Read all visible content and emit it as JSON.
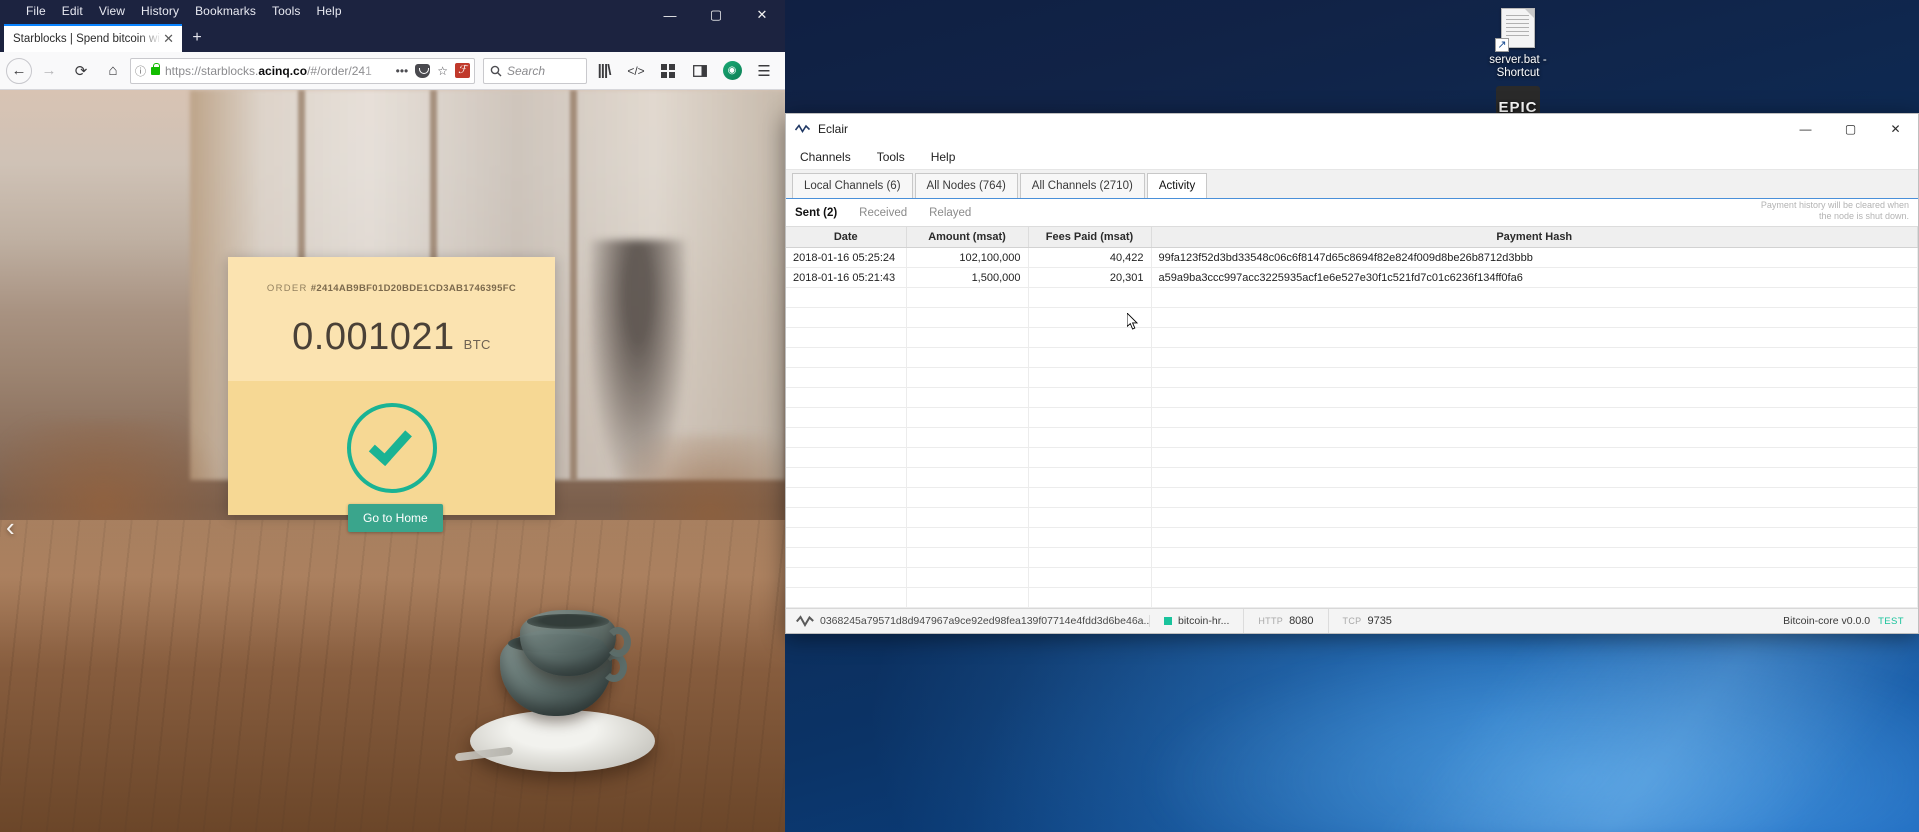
{
  "desktop": {
    "icons": [
      {
        "name": "server.bat - Shortcut",
        "label": "server.bat - Shortcut",
        "type": "bat-shortcut",
        "arrow": "↗"
      },
      {
        "name": "EPIC",
        "label": "EPIC",
        "type": "epic",
        "glyph": "EPIC"
      }
    ]
  },
  "browser": {
    "menu": [
      "File",
      "Edit",
      "View",
      "History",
      "Bookmarks",
      "Tools",
      "Help"
    ],
    "window_controls": {
      "minimize": "—",
      "maximize": "▢",
      "close": "✕"
    },
    "tab": {
      "title": "Starblocks | Spend bitcoin with LN c",
      "close": "✕"
    },
    "new_tab": "+",
    "nav": {
      "back": "←",
      "forward": "→",
      "reload": "⟳",
      "home": "⌂"
    },
    "url": {
      "prefix": "https://starblocks.",
      "domain": "acinq.co",
      "suffix": "/#/order/241",
      "identity_icon": "ⓘ",
      "lock_icon": "lock"
    },
    "urlbar_actions": {
      "more": "•••",
      "pocket": "pocket-icon",
      "bookmark": "☆",
      "extension": "ℱ"
    },
    "search": {
      "placeholder": "Search",
      "icon": "🔍"
    },
    "toolbar_right": {
      "library": "library-icon",
      "devtools": "</>",
      "addons": "grid-icon",
      "sidebar": "sidebar-icon",
      "account": "account-icon",
      "menu": "☰"
    }
  },
  "page": {
    "order_label": "ORDER",
    "order_id": "#2414AB9BF01D20BDE1CD3AB1746395FC",
    "amount": "0.001021",
    "unit": "BTC",
    "status_icon": "check-circle",
    "home_button": "Go to Home",
    "carousel_prev": "‹",
    "accent": "#1ab394",
    "card_top_bg": "#fbe3b0",
    "card_bottom_bg": "#f6d894"
  },
  "eclair": {
    "title": "Eclair",
    "window_controls": {
      "minimize": "—",
      "maximize": "▢",
      "close": "✕"
    },
    "menu": [
      "Channels",
      "Tools",
      "Help"
    ],
    "tabs": [
      {
        "label": "Local Channels (6)",
        "active": false
      },
      {
        "label": "All Nodes (764)",
        "active": false
      },
      {
        "label": "All Channels (2710)",
        "active": false
      },
      {
        "label": "Activity",
        "active": true
      }
    ],
    "subtabs": [
      {
        "label": "Sent (2)",
        "active": true
      },
      {
        "label": "Received",
        "active": false
      },
      {
        "label": "Relayed",
        "active": false
      }
    ],
    "notice_line1": "Payment history will be cleared when",
    "notice_line2": "the node is shut down.",
    "columns": [
      "Date",
      "Amount (msat)",
      "Fees Paid (msat)",
      "Payment Hash"
    ],
    "rows": [
      {
        "date": "2018-01-16 05:25:24",
        "amount": "102,100,000",
        "fees": "40,422",
        "hash": "99fa123f52d3bd33548c06c6f8147d65c8694f82e824f009d8be26b8712d3bbb"
      },
      {
        "date": "2018-01-16 05:21:43",
        "amount": "1,500,000",
        "fees": "20,301",
        "hash": "a59a9ba3ccc997acc3225935acf1e6e527e30f1c521fd7c01c6236f134ff0fa6"
      }
    ],
    "statusbar": {
      "node_id": "0368245a79571d8d947967a9ce92ed98fea139f07714e4fdd3d6be46a...",
      "chain": "bitcoin-hr...",
      "http_key": "HTTP",
      "http_value": "8080",
      "tcp_key": "TCP",
      "tcp_value": "9735",
      "version": "Bitcoin-core v0.0.0",
      "network": "TEST",
      "status_color": "#19c39c"
    }
  }
}
